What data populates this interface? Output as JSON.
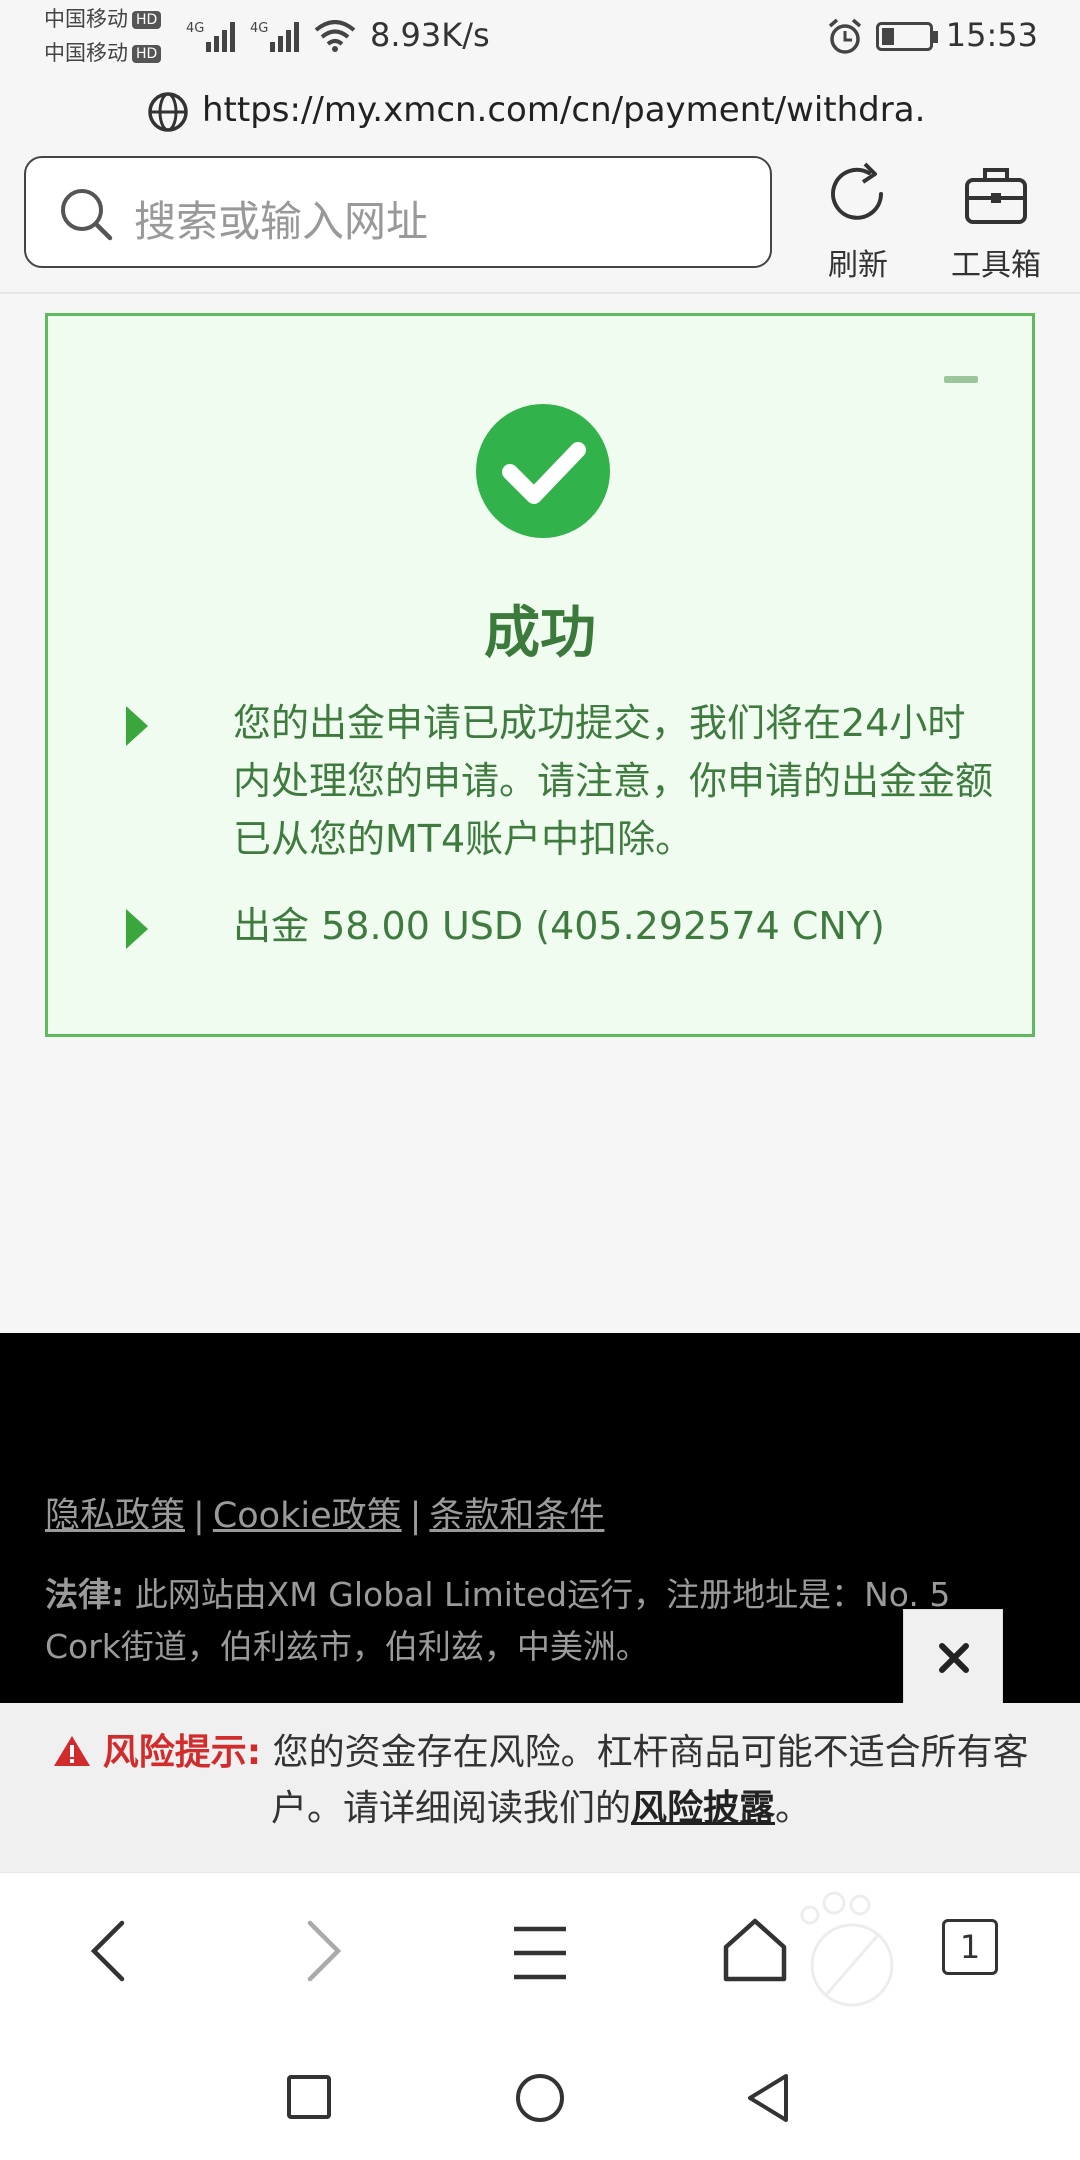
{
  "status_bar": {
    "carrier_1": "中国移动",
    "carrier_2": "中国移动",
    "hd_badge": "HD",
    "network_1": "4G",
    "network_2": "4G",
    "net_speed": "8.93K/s",
    "time": "15:53"
  },
  "browser": {
    "url": "https://my.xmcn.com/cn/payment/withdra...",
    "search_placeholder": "搜索或输入网址",
    "refresh_label": "刷新",
    "toolbox_label": "工具箱",
    "tab_count": "1"
  },
  "success_card": {
    "title": "成功",
    "message": "您的出金申请已成功提交，我们将在24小时内处理您的申请。请注意，你申请的出金金额已从您的MT4账户中扣除。",
    "amount_prefix": "出金",
    "amount": "58.00 USD (405.292574 CNY)"
  },
  "footer": {
    "links": [
      "隐私政策",
      "Cookie政策",
      "条款和条件"
    ],
    "separator": "|",
    "legal_label": "法律:",
    "legal_text": "此网站由XM Global Limited运行，注册地址是：No. 5 Cork街道，伯利兹市，伯利兹，中美洲。"
  },
  "risk_bar": {
    "title": "风险提示:",
    "text": "您的资金存在风险。杠杆商品可能不适合所有客户。请详细阅读我们的",
    "link": "风险披露",
    "end": "。"
  },
  "colors": {
    "success_green": "#31b24a",
    "card_border": "#5dba5d",
    "card_bg": "#f0fcf0",
    "risk_red": "#d12b2b"
  }
}
